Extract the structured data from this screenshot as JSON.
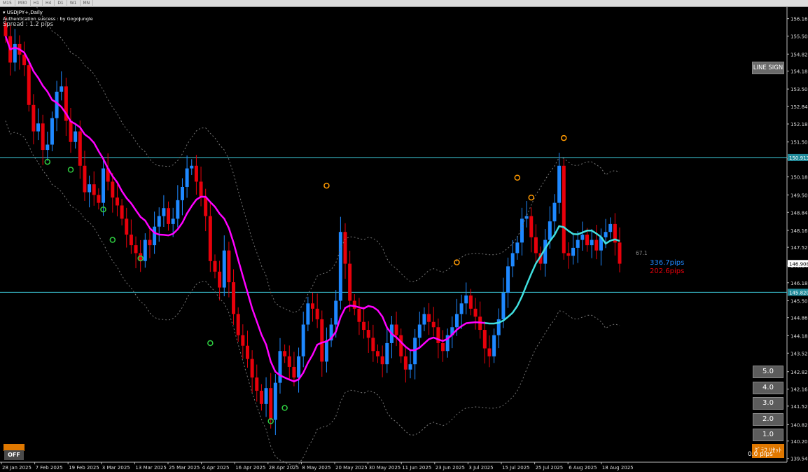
{
  "timeframes": [
    "M15",
    "M30",
    "H1",
    "H4",
    "D1",
    "W1",
    "MN"
  ],
  "header": {
    "symbol_line": "USDJPY+,Daily",
    "auth_line": "Authentication success : by GogoJungle",
    "spread_line": "Spread : 1.2 pips"
  },
  "price_axis": {
    "ymin": 139.4,
    "ymax": 156.6,
    "labels": [
      "156.160",
      "155.500",
      "154.820",
      "154.180",
      "153.500",
      "152.840",
      "152.180",
      "151.500",
      "150.860",
      "150.180",
      "149.500",
      "148.840",
      "148.160",
      "147.520",
      "146.840",
      "146.180",
      "145.500",
      "144.860",
      "144.180",
      "143.520",
      "142.820",
      "142.160",
      "141.520",
      "140.820",
      "140.200",
      "139.540"
    ],
    "markers": [
      {
        "price": 150.913,
        "label": "150.913",
        "color": "#1f8a9a"
      },
      {
        "price": 145.82,
        "label": "145.820",
        "color": "#1f8a9a"
      },
      {
        "price": 146.908,
        "label": "146.908",
        "color": "#ffffff"
      }
    ]
  },
  "date_axis": [
    "28 Jan 2025",
    "7 Feb 2025",
    "19 Feb 2025",
    "3 Mar 2025",
    "13 Mar 2025",
    "25 Mar 2025",
    "4 Apr 2025",
    "16 Apr 2025",
    "28 Apr 2025",
    "8 May 2025",
    "20 May 2025",
    "30 May 2025",
    "11 Jun 2025",
    "23 Jun 2025",
    "3 Jul 2025",
    "15 Jul 2025",
    "25 Jul 2025",
    "6 Aug 2025",
    "18 Aug 2025"
  ],
  "horizontal_lines": [
    150.913,
    145.82
  ],
  "chart_data": {
    "type": "candlestick",
    "bull_color": "#1e88ff",
    "bear_color": "#e8000b",
    "ma_color": "#ff00ff",
    "ma2_color": "#40e0e0",
    "closes": [
      155.5,
      154.5,
      155.2,
      154.8,
      154.4,
      152.9,
      151.9,
      152.2,
      151.2,
      151.4,
      152.4,
      153.4,
      153.6,
      152.3,
      151.5,
      151.9,
      150.6,
      149.6,
      149.9,
      149.5,
      149.2,
      150.5,
      150.0,
      149.4,
      149.1,
      148.6,
      148.0,
      147.6,
      147.3,
      147.0,
      147.8,
      147.6,
      148.3,
      148.7,
      149.0,
      148.4,
      148.6,
      149.3,
      149.8,
      150.5,
      150.6,
      150.0,
      149.4,
      148.7,
      147.0,
      146.6,
      146.0,
      147.4,
      146.2,
      145.0,
      144.2,
      143.8,
      143.3,
      142.6,
      142.1,
      141.6,
      142.2,
      141.0,
      142.4,
      143.6,
      143.4,
      143.0,
      142.6,
      143.4,
      144.6,
      145.4,
      145.2,
      144.8,
      143.2,
      144.0,
      144.6,
      145.5,
      148.1,
      146.9,
      145.5,
      145.2,
      144.7,
      144.4,
      144.1,
      143.6,
      143.4,
      143.1,
      143.9,
      144.6,
      144.2,
      143.4,
      142.9,
      143.1,
      144.1,
      144.6,
      145.0,
      144.7,
      144.5,
      143.9,
      143.6,
      144.2,
      144.5,
      145.0,
      145.4,
      145.7,
      145.2,
      144.9,
      144.4,
      143.7,
      143.4,
      144.2,
      144.8,
      145.8,
      146.8,
      147.3,
      147.7,
      148.6,
      148.7,
      147.9,
      147.3,
      146.9,
      147.8,
      148.5,
      149.2,
      150.6,
      147.3,
      147.2,
      147.5,
      147.8,
      148.0,
      147.6,
      147.8,
      147.4,
      147.9,
      148.1,
      148.4,
      147.7,
      146.9
    ],
    "ma_pips": {
      "up": "336.7pips",
      "down": "202.6pips",
      "level": "67.1"
    }
  },
  "buttons": {
    "line_sign": "LINE SIGN",
    "levels": [
      "5.0",
      "4.0",
      "3.0",
      "2.0",
      "1.0"
    ],
    "off": "OFF",
    "orange_right": "ｸﾞﾗﾌ ﾘｾｯﾄ",
    "bottom_pips": "0.0 pips"
  }
}
